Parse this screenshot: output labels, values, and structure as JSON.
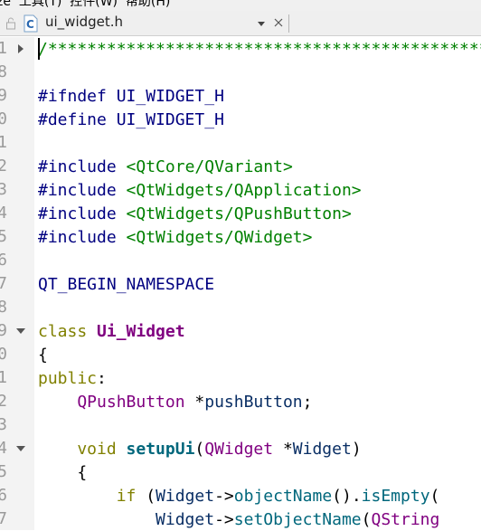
{
  "menubar": {
    "text": "ze  工具(T)  控件(W)  帮助(H)"
  },
  "tab": {
    "title": "ui_widget.h",
    "file_icon_label": "C"
  },
  "gutter": [
    {
      "num": "1",
      "fold": "collapsed"
    },
    {
      "num": "8",
      "fold": ""
    },
    {
      "num": "9",
      "fold": ""
    },
    {
      "num": "0",
      "fold": ""
    },
    {
      "num": "1",
      "fold": ""
    },
    {
      "num": "2",
      "fold": ""
    },
    {
      "num": "3",
      "fold": ""
    },
    {
      "num": "4",
      "fold": ""
    },
    {
      "num": "5",
      "fold": ""
    },
    {
      "num": "6",
      "fold": ""
    },
    {
      "num": "7",
      "fold": ""
    },
    {
      "num": "8",
      "fold": ""
    },
    {
      "num": "9",
      "fold": "expanded"
    },
    {
      "num": "0",
      "fold": ""
    },
    {
      "num": "1",
      "fold": ""
    },
    {
      "num": "2",
      "fold": ""
    },
    {
      "num": "3",
      "fold": ""
    },
    {
      "num": "4",
      "fold": "expanded"
    },
    {
      "num": "5",
      "fold": ""
    },
    {
      "num": "6",
      "fold": ""
    },
    {
      "num": "7",
      "fold": ""
    }
  ],
  "code": {
    "l1": "/**************************************************",
    "l3": "#ifndef UI_WIDGET_H",
    "l4": "#define UI_WIDGET_H",
    "l6a": "#include ",
    "l6b": "<QtCore/QVariant>",
    "l7a": "#include ",
    "l7b": "<QtWidgets/QApplication>",
    "l8a": "#include ",
    "l8b": "<QtWidgets/QPushButton>",
    "l9a": "#include ",
    "l9b": "<QtWidgets/QWidget>",
    "l11": "QT_BEGIN_NAMESPACE",
    "l13a": "class ",
    "l13b": "Ui_Widget",
    "l14": "{",
    "l15a": "public",
    "l15b": ":",
    "l16a": "    QPushButton",
    "l16b": " *",
    "l16c": "pushButton",
    "l16d": ";",
    "l18a": "    void ",
    "l18b": "setupUi",
    "l18c": "(",
    "l18d": "QWidget",
    "l18e": " *",
    "l18f": "Widget",
    "l18g": ")",
    "l19": "    {",
    "l20a": "        if ",
    "l20b": "(",
    "l20c": "Widget",
    "l20d": "->",
    "l20e": "objectName",
    "l20f": "().",
    "l20g": "isEmpty",
    "l20h": "(",
    "l21a": "            Widget",
    "l21b": "->",
    "l21c": "setObjectName",
    "l21d": "(",
    "l21e": "QString"
  }
}
